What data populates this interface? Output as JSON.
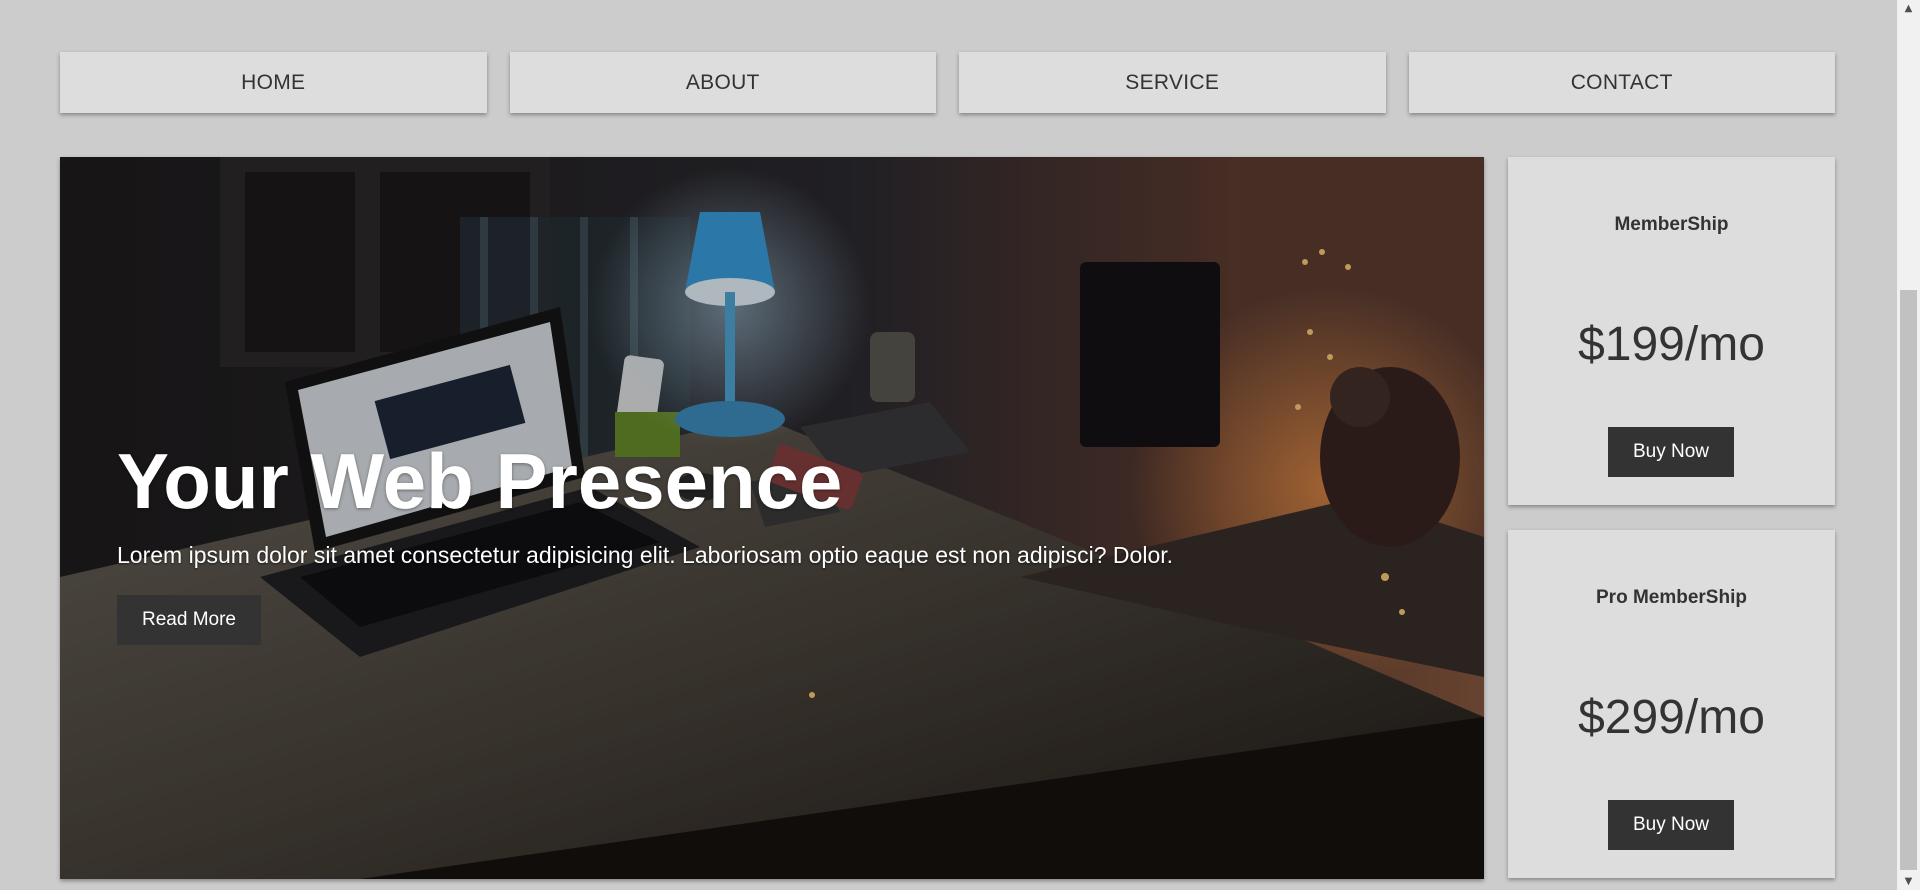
{
  "nav": {
    "items": [
      {
        "label": "HOME"
      },
      {
        "label": "ABOUT"
      },
      {
        "label": "SERVICE"
      },
      {
        "label": "CONTACT"
      }
    ]
  },
  "hero": {
    "title": "Your Web Presence",
    "text": "Lorem ipsum dolor sit amet consectetur adipisicing elit. Laboriosam optio eaque est non adipisci? Dolor.",
    "button_label": "Read More",
    "image_description_icon": "desk-photo-image"
  },
  "cards": [
    {
      "title": "MemberShip",
      "price": "$199/mo",
      "button_label": "Buy Now"
    },
    {
      "title": "Pro MemberShip",
      "price": "$299/mo",
      "button_label": "Buy Now"
    }
  ],
  "scrollbar": {
    "up_icon": "chevron-up-icon",
    "down_icon": "chevron-down-icon",
    "up_glyph": "▲",
    "down_glyph": "▼"
  },
  "colors": {
    "page_bg": "#cccccc",
    "panel_bg": "#dddddd",
    "button_bg": "#333333",
    "text_dark": "#333333",
    "text_light": "#ffffff"
  }
}
